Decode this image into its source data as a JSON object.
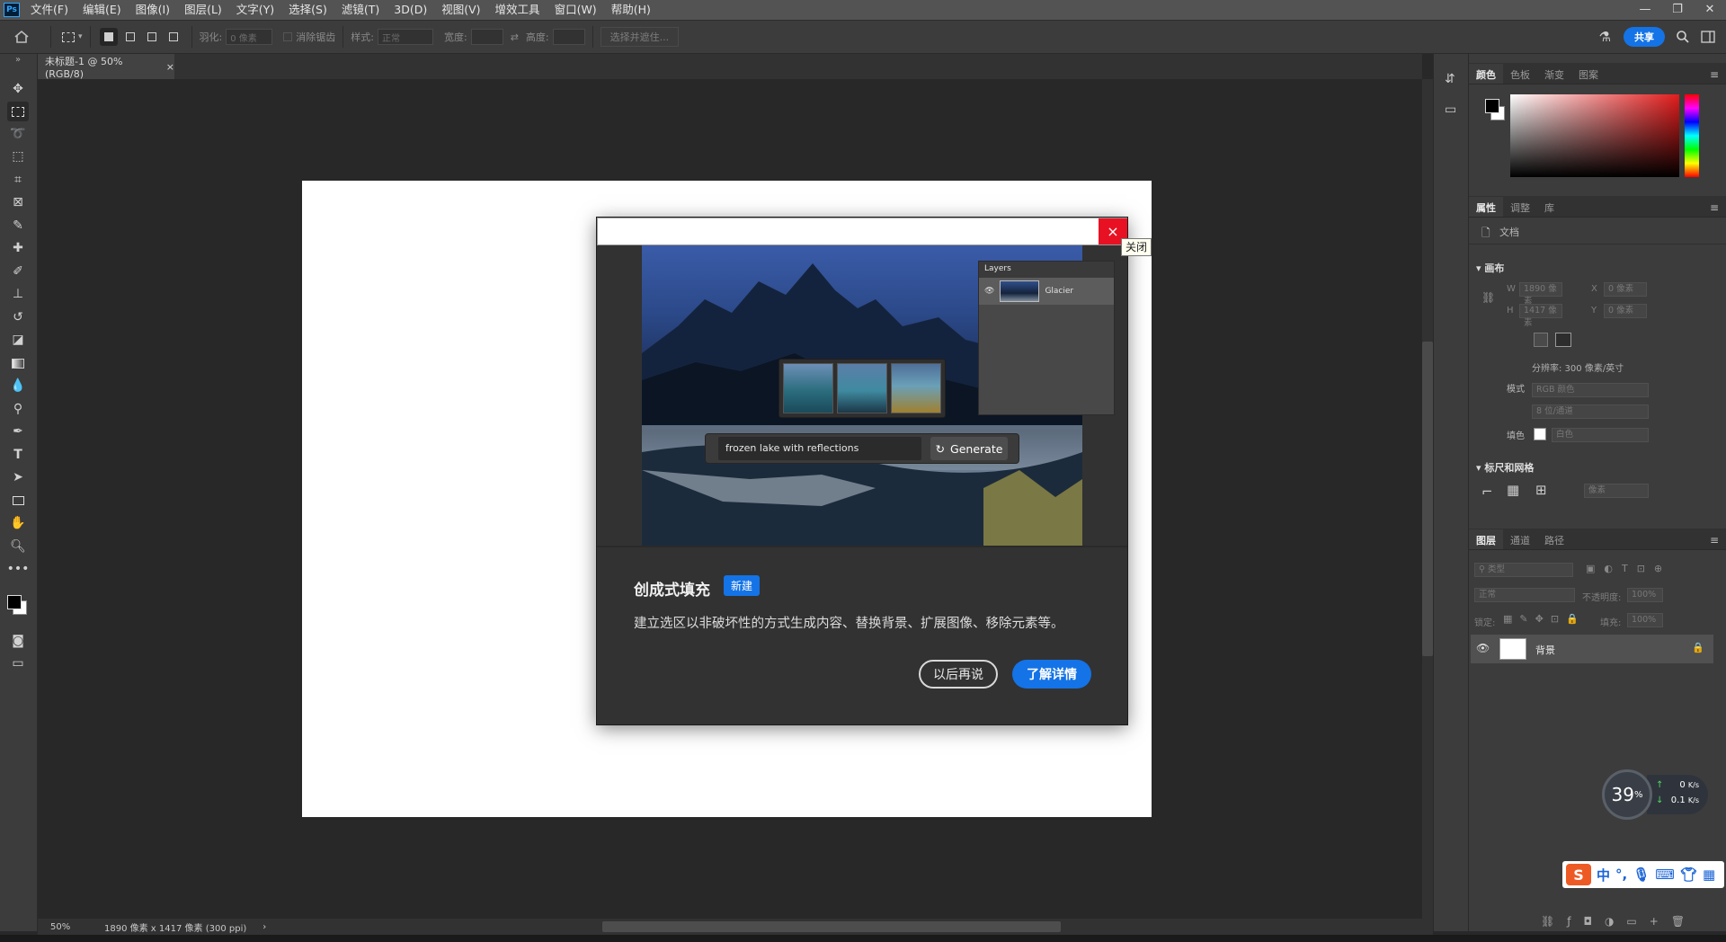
{
  "app": {
    "logo": "Ps",
    "menu": [
      "文件(F)",
      "编辑(E)",
      "图像(I)",
      "图层(L)",
      "文字(Y)",
      "选择(S)",
      "滤镜(T)",
      "3D(D)",
      "视图(V)",
      "增效工具",
      "窗口(W)",
      "帮助(H)"
    ],
    "window_controls": [
      "minimize-icon",
      "restore-icon",
      "close-icon"
    ]
  },
  "options": {
    "feather_label": "羽化:",
    "feather_value": "0 像素",
    "antialias_label": "消除锯齿",
    "style_label": "样式:",
    "style_value": "正常",
    "width_label": "宽度:",
    "height_label": "高度:",
    "select_mask_label": "选择并遮住...",
    "share_label": "共享"
  },
  "document": {
    "tab_title": "未标题-1 @ 50%(RGB/8)",
    "tab_close": "×",
    "zoom": "50%",
    "info": "1890 像素 x 1417 像素 (300 ppi)"
  },
  "dialog": {
    "close_label": "×",
    "close_tooltip": "关闭",
    "title": "创成式填充",
    "badge": "新建",
    "body": "建立选区以非破坏性的方式生成内容、替换背景、扩展图像、移除元素等。",
    "later_label": "以后再说",
    "learn_label": "了解详情",
    "hero": {
      "layers_title": "Layers",
      "layer_name": "Glacier",
      "prompt_text": "frozen lake with reflections",
      "generate_label": "Generate"
    }
  },
  "panels": {
    "color_tabs": [
      "颜色",
      "色板",
      "渐变",
      "图案"
    ],
    "props_tabs": [
      "属性",
      "调整",
      "库"
    ],
    "doc_label": "文档",
    "canvas_section": "画布",
    "w_label": "W",
    "w_value": "1890 像素",
    "h_label": "H",
    "h_value": "1417 像素",
    "x_label": "X",
    "x_value": "0 像素",
    "y_label": "Y",
    "y_value": "0 像素",
    "resolution": "分辨率: 300 像素/英寸",
    "mode_label": "模式",
    "mode_value": "RGB 颜色",
    "depth_value": "8 位/通道",
    "fill_label": "填色",
    "fill_value": "白色",
    "rulers_section": "标尺和网格",
    "ruler_unit": "像素",
    "layers_tabs": [
      "图层",
      "通道",
      "路径"
    ],
    "kind_filter": "类型",
    "blend_mode": "正常",
    "opacity_label": "不透明度:",
    "opacity_value": "100%",
    "lock_label": "锁定:",
    "fill2_label": "填充:",
    "fill2_value": "100%",
    "bg_layer_name": "背景"
  },
  "overlay": {
    "cpu_value": "39",
    "cpu_unit": "%",
    "up_speed": "0",
    "up_unit": "K/s",
    "down_speed": "0.1",
    "down_unit": "K/s",
    "ime_label": "中"
  }
}
